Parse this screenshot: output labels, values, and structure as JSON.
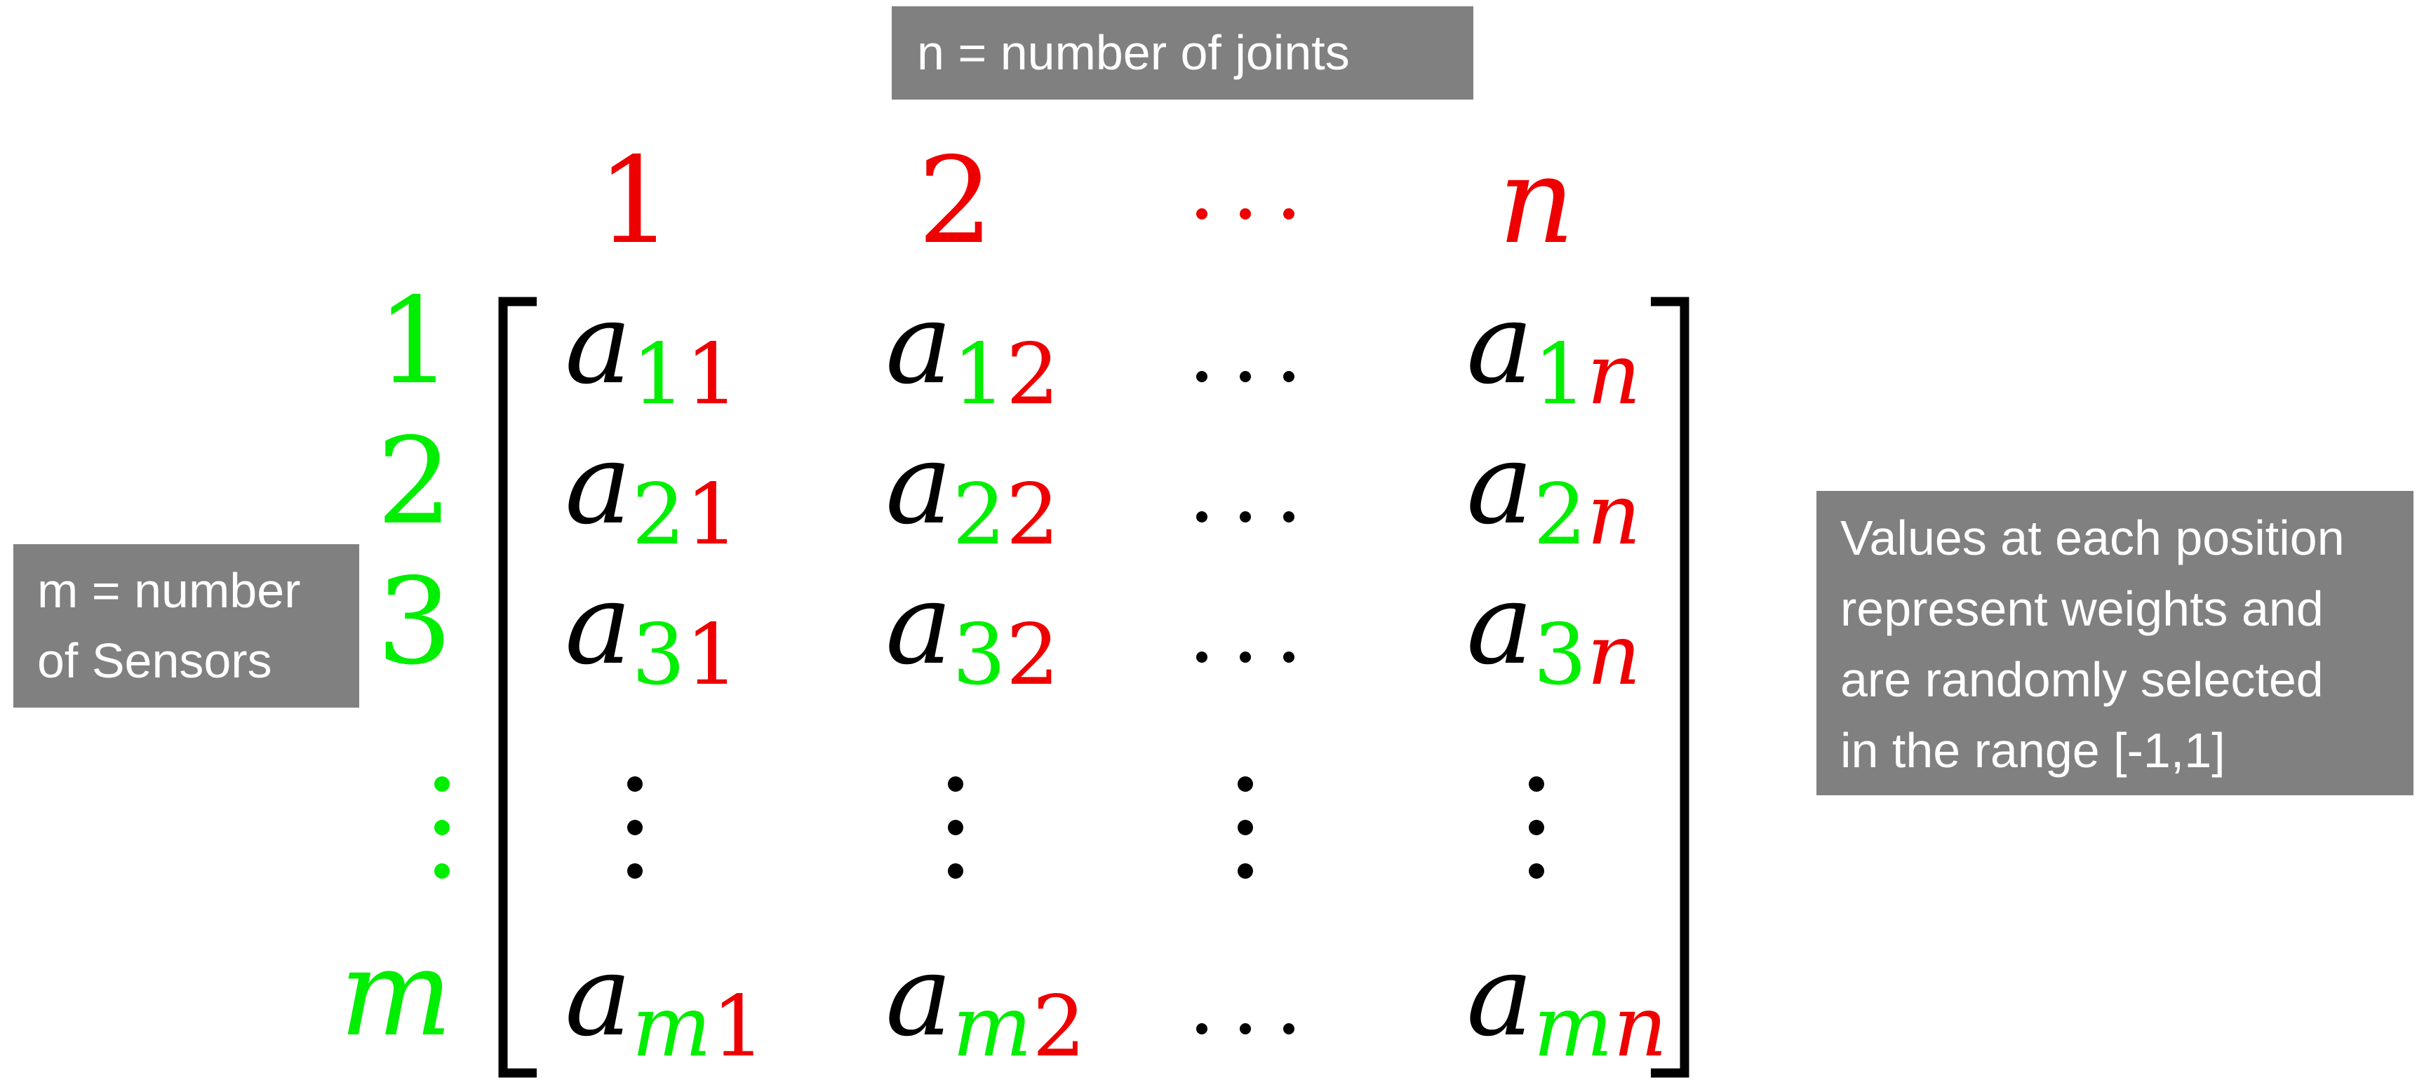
{
  "annotations": {
    "joints": "n = number of joints",
    "sensors": [
      "m = number",
      "of Sensors"
    ],
    "weights": [
      "Values at each position",
      "represent weights and",
      "are randomly selected",
      "in the range [-1,1]"
    ]
  },
  "matrix": {
    "base_symbol": "a",
    "column_headers": [
      "1",
      "2",
      "⋯",
      "n"
    ],
    "row_headers": [
      "1",
      "2",
      "3",
      "⋮",
      "m"
    ],
    "row_index_values": [
      "1",
      "2",
      "3",
      "",
      "m"
    ],
    "column_index_values": [
      "1",
      "2",
      "",
      "n"
    ],
    "ellipsis_horizontal": "…",
    "ellipsis_vertical": "⋮"
  },
  "colors": {
    "row_color": "#00ee00",
    "column_color": "#ee0000",
    "ink": "#000000",
    "box_fill": "#808080",
    "box_text": "#ffffff"
  }
}
